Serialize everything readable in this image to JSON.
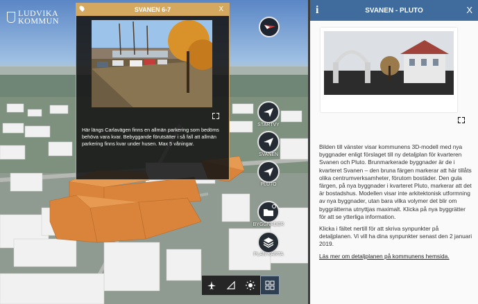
{
  "logo": {
    "line1": "LUDVIKA",
    "line2": "KOMMUN"
  },
  "popup": {
    "title": "SVANEN 6-7",
    "close": "X",
    "text": "Här längs Carlavägen finns en allmän parkering som bedöms behöva vara kvar. Bebyggande förutsätter i så fall att allmän parkering finns kvar under husen. Max 5 våningar."
  },
  "nav": [
    {
      "label": "STARTVY",
      "icon": "paper-plane-icon"
    },
    {
      "label": "SVANEN",
      "icon": "paper-plane-icon"
    },
    {
      "label": "PLUTO",
      "icon": "paper-plane-icon"
    },
    {
      "label": "BYGGNADER",
      "icon": "folder-icon"
    },
    {
      "label": "PLAN KARTA",
      "icon": "layers-icon"
    }
  ],
  "toolbar": [
    "airplane-icon",
    "measure-icon",
    "sun-icon",
    "grid-icon"
  ],
  "panel": {
    "title": "SVANEN - PLUTO",
    "info": "i",
    "close": "X",
    "p1": "Bilden till vänster visar kommunens 3D-modell med nya byggnader enligt förslaget till ny detaljplan för kvarteren Svanen och Pluto. Brunmarkerade byggnader är de i kvarteret Svanen – den bruna färgen markerar att här tillåts olika centrumverksamheter, förutom bostäder. Den gula färgen, på nya byggnader i kvarteret Pluto, markerar att det är bostadshus. Modellen visar inte arkitektonisk utformning av nya byggnader, utan bara vilka volymer det blir om byggrätterna utnyttjas maximalt.  Klicka på nya byggrätter för att se ytterliga information.",
    "p2": "Klicka i fältet nertill för att skriva synpunkter på detaljplanen. Vi vill ha dina synpunkter senast den 2 januari 2019.",
    "link": "Läs mer om detaljplanen på kommunens hemsida."
  },
  "colors": {
    "accent_gold": "#d4a95f",
    "panel_blue": "#3f6b9d",
    "building_orange": "#d9843a"
  }
}
